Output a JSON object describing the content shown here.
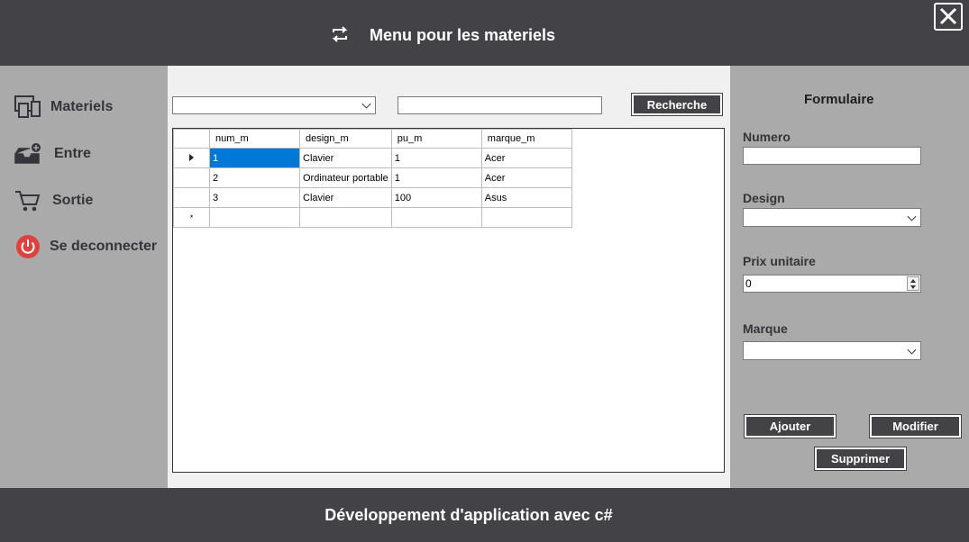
{
  "header": {
    "title": "Menu pour les materiels",
    "title_icon": "refresh-icon",
    "close_icon": "close-icon"
  },
  "sidebar": {
    "items": [
      {
        "label": "Materiels",
        "icon": "devices-icon"
      },
      {
        "label": "Entre",
        "icon": "inbox-add-icon"
      },
      {
        "label": "Sortie",
        "icon": "cart-icon"
      },
      {
        "label": "Se deconnecter",
        "icon": "power-icon"
      }
    ]
  },
  "search": {
    "filter_value": "",
    "query_value": "",
    "button_label": "Recherche"
  },
  "grid": {
    "columns": [
      "num_m",
      "design_m",
      "pu_m",
      "marque_m"
    ],
    "rows": [
      [
        "1",
        "Clavier",
        "1",
        "Acer"
      ],
      [
        "2",
        "Ordinateur portable",
        "1",
        "Acer"
      ],
      [
        "3",
        "Clavier",
        "100",
        "Asus"
      ]
    ],
    "new_row_marker": "*"
  },
  "form": {
    "title": "Formulaire",
    "numero_label": "Numero",
    "numero_value": "",
    "design_label": "Design",
    "design_value": "",
    "prix_label": "Prix unitaire",
    "prix_value": "0",
    "marque_label": "Marque",
    "marque_value": "",
    "ajouter_label": "Ajouter",
    "modifier_label": "Modifier",
    "supprimer_label": "Supprimer"
  },
  "footer": {
    "text": "Développement d'application avec c#"
  },
  "colors": {
    "dark": "#434247",
    "panel": "#aaaaaa",
    "selection": "#0078d7",
    "power_red": "#e0413f"
  }
}
